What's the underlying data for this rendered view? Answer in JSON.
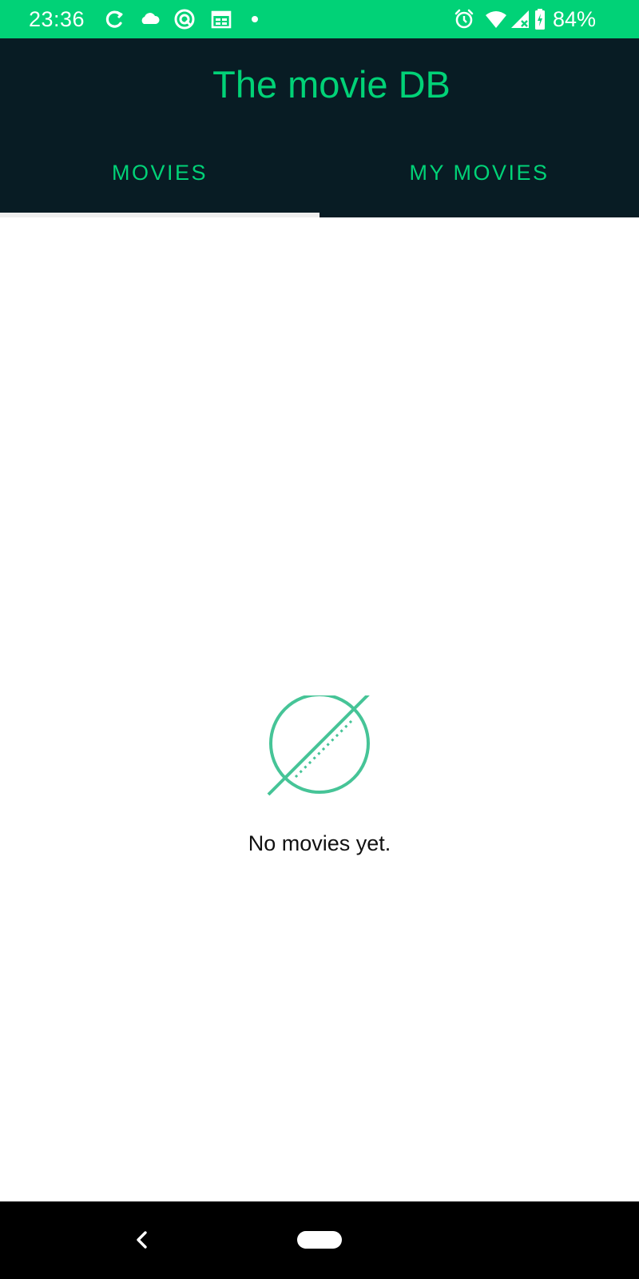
{
  "status_bar": {
    "time": "23:36",
    "battery_percent": "84%",
    "icons": [
      "sync-icon",
      "cloud-icon",
      "app-notification-icon",
      "calendar-icon",
      "dot-icon",
      "alarm-icon",
      "wifi-icon",
      "signal-icon",
      "battery-icon"
    ]
  },
  "app_bar": {
    "title": "The movie DB"
  },
  "tabs": {
    "items": [
      {
        "label": "MOVIES",
        "selected": true
      },
      {
        "label": "MY MOVIES",
        "selected": false
      }
    ]
  },
  "empty_state": {
    "icon": "no-movies-icon",
    "message": "No movies yet."
  },
  "nav_bar": {
    "buttons": [
      "back-button",
      "home-button"
    ]
  },
  "colors": {
    "accent": "#01d277",
    "app_bar_bg": "#081c24",
    "status_bar_bg": "#01d277",
    "empty_icon": "#46c497"
  }
}
